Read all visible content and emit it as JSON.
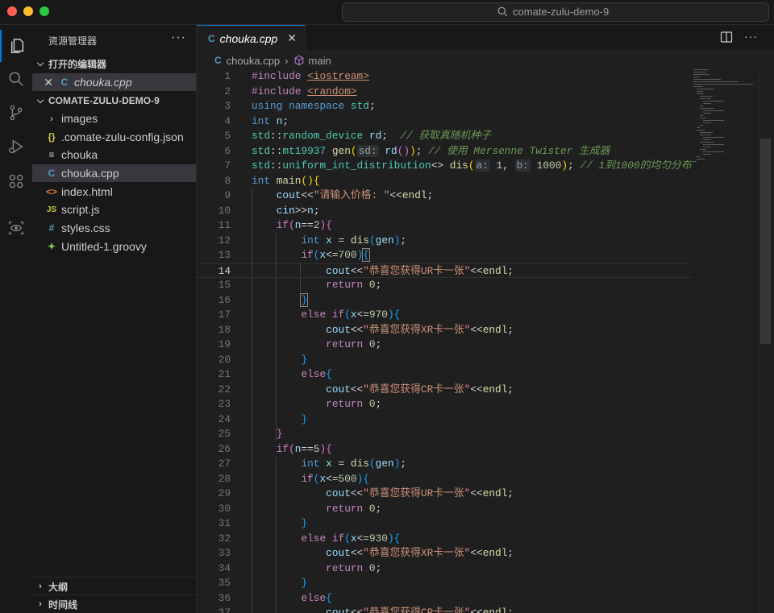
{
  "window": {
    "search_text": "comate-zulu-demo-9"
  },
  "sidebar": {
    "title": "资源管理器",
    "more": "···",
    "open_editors_label": "打开的编辑器",
    "open_editor_file": "chouka.cpp",
    "folder_label": "COMATE-ZULU-DEMO-9",
    "files": [
      {
        "label": "images",
        "icon": "folder-chevron-icon"
      },
      {
        "label": ".comate-zulu-config.json",
        "icon": "json-icon"
      },
      {
        "label": "chouka",
        "icon": "text-file-icon"
      },
      {
        "label": "chouka.cpp",
        "icon": "cpp-icon"
      },
      {
        "label": "index.html",
        "icon": "html-icon"
      },
      {
        "label": "script.js",
        "icon": "js-icon"
      },
      {
        "label": "styles.css",
        "icon": "css-icon"
      },
      {
        "label": "Untitled-1.groovy",
        "icon": "groovy-icon"
      }
    ],
    "outline_label": "大纲",
    "timeline_label": "时间线"
  },
  "tab": {
    "label": "chouka.cpp"
  },
  "breadcrumb": {
    "file": "chouka.cpp",
    "symbol": "main"
  },
  "editor": {
    "current_line": 14,
    "line_numbers": [
      "1",
      "2",
      "3",
      "4",
      "5",
      "6",
      "7",
      "8",
      "9",
      "10",
      "11",
      "12",
      "13",
      "14",
      "15",
      "16",
      "17",
      "18",
      "19",
      "20",
      "21",
      "22",
      "23",
      "24",
      "25",
      "26",
      "27",
      "28",
      "29",
      "30",
      "31",
      "32",
      "33",
      "34",
      "35",
      "36",
      "37"
    ],
    "tokens": {
      "include": "#include",
      "iostream": "<iostream>",
      "random": "<random>",
      "using": "using",
      "namespace": "namespace",
      "std": "std",
      "int": "int",
      "n": "n",
      "random_device": "random_device",
      "rd": "rd",
      "comment4": "// 获取真随机种子",
      "mt19937": "mt19937",
      "gen": "gen",
      "hint_sd": "sd:",
      "comment6": "// 使用 Mersenne Twister 生成器",
      "uniform": "uniform_int_distribution",
      "dis": "dis",
      "hint_a": "a:",
      "num1": "1",
      "hint_b": "b:",
      "num1000": "1000",
      "comment7": "// 1到1000的均匀分布",
      "main": "main",
      "cout": "cout",
      "cin": "cin",
      "endl": "endl",
      "prompt": "\"请输入价格: \"",
      "if": "if",
      "else": "else",
      "return": "return",
      "x": "x",
      "zero": "0",
      "num2": "2",
      "num5": "5",
      "num700": "700",
      "num970": "970",
      "num500": "500",
      "num930": "930",
      "ur": "\"恭喜您获得UR卡一张\"",
      "xr": "\"恭喜您获得XR卡一张\"",
      "cr": "\"恭喜您获得CR卡一张\""
    }
  }
}
